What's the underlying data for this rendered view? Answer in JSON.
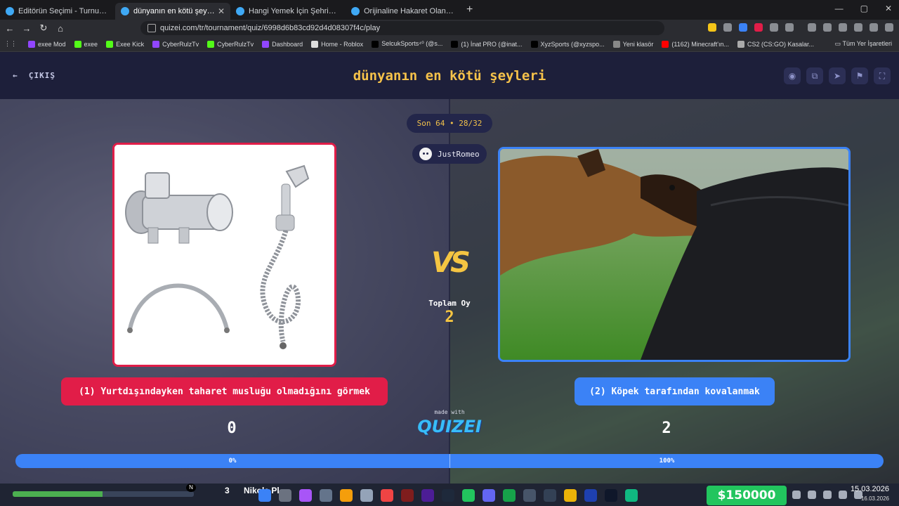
{
  "browser": {
    "tabs": [
      {
        "label": "Editörün Seçimi - Turnuva - Quizei",
        "active": false
      },
      {
        "label": "dünyanın en kötü şeyleri - Tier L",
        "active": true
      },
      {
        "label": "Hangi Yemek İçin Şehrine Gidersin?",
        "active": false
      },
      {
        "label": "Orijinaline Hakaret Olan Yemek - Tier",
        "active": false
      }
    ],
    "url": "quizei.com/tr/tournament/quiz/6998d6b83cd92d4d08307f4c/play",
    "bookmarks": [
      {
        "label": "exee Mod",
        "color": "#9146ff"
      },
      {
        "label": "exee",
        "color": "#53fc18"
      },
      {
        "label": "Exee Kick",
        "color": "#53fc18"
      },
      {
        "label": "CyberRulzTv",
        "color": "#9146ff"
      },
      {
        "label": "CyberRulzTv",
        "color": "#53fc18"
      },
      {
        "label": "Dashboard",
        "color": "#9146ff"
      },
      {
        "label": "Home - Roblox",
        "color": "#dddddd"
      },
      {
        "label": "SelcukSports⁴⁰ (@s...",
        "color": "#000000"
      },
      {
        "label": "(1) İnat PRO (@inat...",
        "color": "#000000"
      },
      {
        "label": "XyzSports (@xyzspo...",
        "color": "#000000"
      },
      {
        "label": "Yeni klasör",
        "color": "#888888"
      },
      {
        "label": "(1162) Minecraft'ın...",
        "color": "#ff0000"
      },
      {
        "label": "CS2 (CS:GO) Kasalar...",
        "color": "#aaaaaa"
      }
    ],
    "all_bookmarks": "Tüm Yer İşaretleri"
  },
  "header": {
    "exit_label": "ÇIKIŞ",
    "title": "dünyanın en kötü şeyleri"
  },
  "game": {
    "round_label": "Son 64 • 28/32",
    "username": "JustRomeo",
    "vs_label": "VS",
    "total_votes_label": "Toplam Oy",
    "total_votes": "2",
    "left_option": "(1) Yurtdışındayken taharet musluğu olmadığını görmek",
    "right_option": "(2) Köpek tarafından kovalanmak",
    "left_count": "0",
    "right_count": "2",
    "left_percent_label": "0%",
    "right_percent_label": "100%",
    "left_share": 0.0,
    "made_with": "made with",
    "brand": "QUIZEI",
    "colors": {
      "left": "#e11d48",
      "right": "#3b82f6",
      "accent": "#f5c542"
    }
  },
  "taskbar": {
    "n_badge": "N",
    "digit": "3",
    "window_label": "Nikola Pl",
    "money": "$150000",
    "time": "15.03.2026",
    "date": "16.03.2026"
  }
}
